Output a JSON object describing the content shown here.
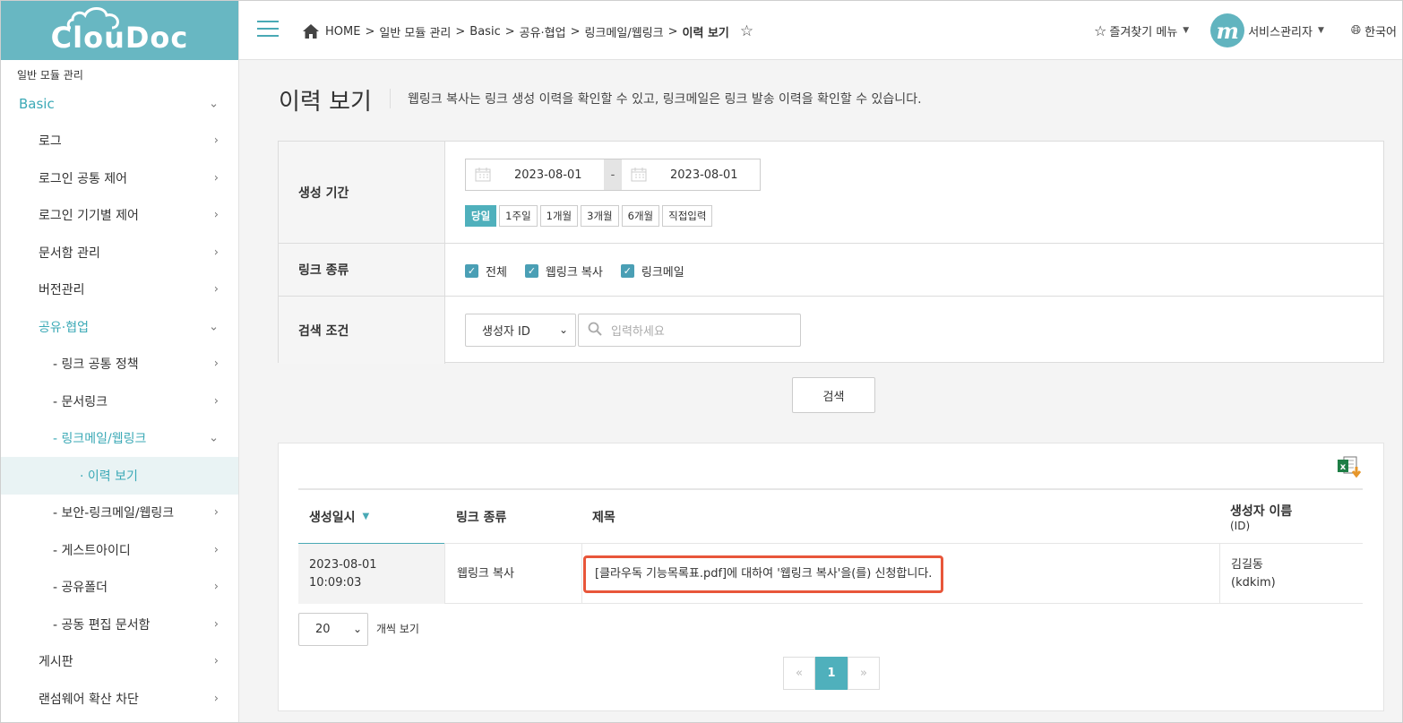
{
  "app": {
    "logo": "ClouDoc"
  },
  "sidebar": {
    "section": "일반 모듈 관리",
    "items": [
      {
        "label": "Basic",
        "arrow": "⌄"
      },
      {
        "label": "로그",
        "arrow": "›"
      },
      {
        "label": "로그인 공통 제어",
        "arrow": "›"
      },
      {
        "label": "로그인 기기별 제어",
        "arrow": "›"
      },
      {
        "label": "문서함 관리",
        "arrow": "›"
      },
      {
        "label": "버전관리",
        "arrow": "›"
      },
      {
        "label": "공유·협업",
        "arrow": "⌄"
      },
      {
        "label": "- 링크 공통 정책",
        "arrow": "›"
      },
      {
        "label": "- 문서링크",
        "arrow": "›"
      },
      {
        "label": "- 링크메일/웹링크",
        "arrow": "⌄"
      },
      {
        "label": "· 이력 보기",
        "arrow": ""
      },
      {
        "label": "- 보안-링크메일/웹링크",
        "arrow": "›"
      },
      {
        "label": "- 게스트아이디",
        "arrow": "›"
      },
      {
        "label": "- 공유폴더",
        "arrow": "›"
      },
      {
        "label": "- 공동 편집 문서함",
        "arrow": "›"
      },
      {
        "label": "게시판",
        "arrow": "›"
      },
      {
        "label": "랜섬웨어 확산 차단",
        "arrow": "›"
      }
    ]
  },
  "header": {
    "breadcrumb": [
      "HOME",
      "일반 모듈 관리",
      "Basic",
      "공유·협업",
      "링크메일/웹링크",
      "이력 보기"
    ],
    "separator": ">",
    "favorites": "즐겨찾기 메뉴",
    "avatar_letter": "m",
    "user": "서비스관리자",
    "language": "한국어"
  },
  "page": {
    "title": "이력 보기",
    "description": "웹링크 복사는 링크 생성 이력을 확인할 수 있고, 링크메일은 링크 발송 이력을 확인할 수 있습니다."
  },
  "filter": {
    "period_label": "생성 기간",
    "date_from": "2023-08-01",
    "date_to": "2023-08-01",
    "date_sep": "-",
    "quick_ranges": [
      "당일",
      "1주일",
      "1개월",
      "3개월",
      "6개월",
      "직접입력"
    ],
    "active_range": "당일",
    "link_type_label": "링크 종류",
    "link_types": [
      "전체",
      "웹링크 복사",
      "링크메일"
    ],
    "condition_label": "검색 조건",
    "condition_select": "생성자 ID",
    "search_placeholder": "입력하세요",
    "search_button": "검색"
  },
  "table": {
    "columns": {
      "created": "생성일시",
      "type": "링크 종류",
      "title": "제목",
      "creator": "생성자 이름",
      "creator_sub": "(ID)"
    },
    "rows": [
      {
        "date": "2023-08-01",
        "time": "10:09:03",
        "type": "웹링크 복사",
        "title": "[클라우독 기능목록표.pdf]에 대하여 '웹링크 복사'을(를) 신청합니다.",
        "creator_name": "김길동",
        "creator_id": "(kdkim)"
      }
    ]
  },
  "pagination": {
    "page_size": "20",
    "per_label": "개씩 보기",
    "prev": "«",
    "current": "1",
    "next": "»"
  },
  "colors": {
    "accent": "#4fb0bc",
    "logo_bg": "#68b7c2",
    "highlight_border": "#e8563a",
    "checkbox": "#4a9fb5"
  }
}
